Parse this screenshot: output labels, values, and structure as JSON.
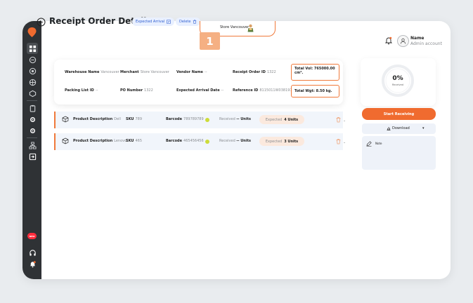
{
  "sidebar": {
    "new_badge": "NEW",
    "icons": [
      "grid-icon",
      "box-icon",
      "target-icon",
      "box-outline-icon",
      "layers-icon",
      "clipboard-icon",
      "gear-icon",
      "settings-icon",
      "network-icon",
      "export-icon",
      "headphones-icon",
      "bell-icon"
    ]
  },
  "header": {
    "title": "Receipt Order Details",
    "expected_arrival_chip": "Expected Arrival",
    "delete_chip": "Delete",
    "store_name": "Store Vancouver",
    "step_number": "1",
    "user_name": "Name",
    "user_role": "Admin account"
  },
  "info": {
    "warehouse_name": {
      "label": "Warehouse Name",
      "value": "Vancouver"
    },
    "merchant": {
      "label": "Merchant",
      "value": "Store Vancouver"
    },
    "vendor_name": {
      "label": "Vendor Name",
      "value": "--"
    },
    "receipt_order_id": {
      "label": "Receipt Order ID",
      "value": "1322"
    },
    "packing_list_id": {
      "label": "Packing List ID",
      "value": "--"
    },
    "po_number": {
      "label": "PO Number",
      "value": "1322"
    },
    "expected_arrival_date": {
      "label": "Expected Arrival Date",
      "value": "--"
    },
    "reference_id": {
      "label": "Reference ID",
      "value": "8115011W038197"
    },
    "total_vol": "Total Vol: 765000.00 cm³.",
    "total_wgt": "Total Wgt: 8.50 kg."
  },
  "products": [
    {
      "desc_label": "Product Description",
      "desc_value": "Dell",
      "sku_label": "SKU",
      "sku_value": "789",
      "barcode_label": "Barcode",
      "barcode_value": "789789789",
      "received_label": "Received",
      "received_value": "-- Units",
      "expected_label": "Expected",
      "expected_value": "4 Units"
    },
    {
      "desc_label": "Product Description",
      "desc_value": "Lenovo",
      "sku_label": "SKU",
      "sku_value": "465",
      "barcode_label": "Barcode",
      "barcode_value": "465456456",
      "received_label": "Received",
      "received_value": "-- Units",
      "expected_label": "Expected",
      "expected_value": "3 Units"
    }
  ],
  "progress": {
    "percent_text": "0%",
    "label": "Received",
    "value": 0
  },
  "actions": {
    "start_receiving": "Start Receiving",
    "download": "Download",
    "note": "Note"
  },
  "colors": {
    "accent": "#f06b2f",
    "sidebar": "#2f3235",
    "row_bg": "#f1f5fb",
    "chip_bg": "#e9f0ff"
  }
}
